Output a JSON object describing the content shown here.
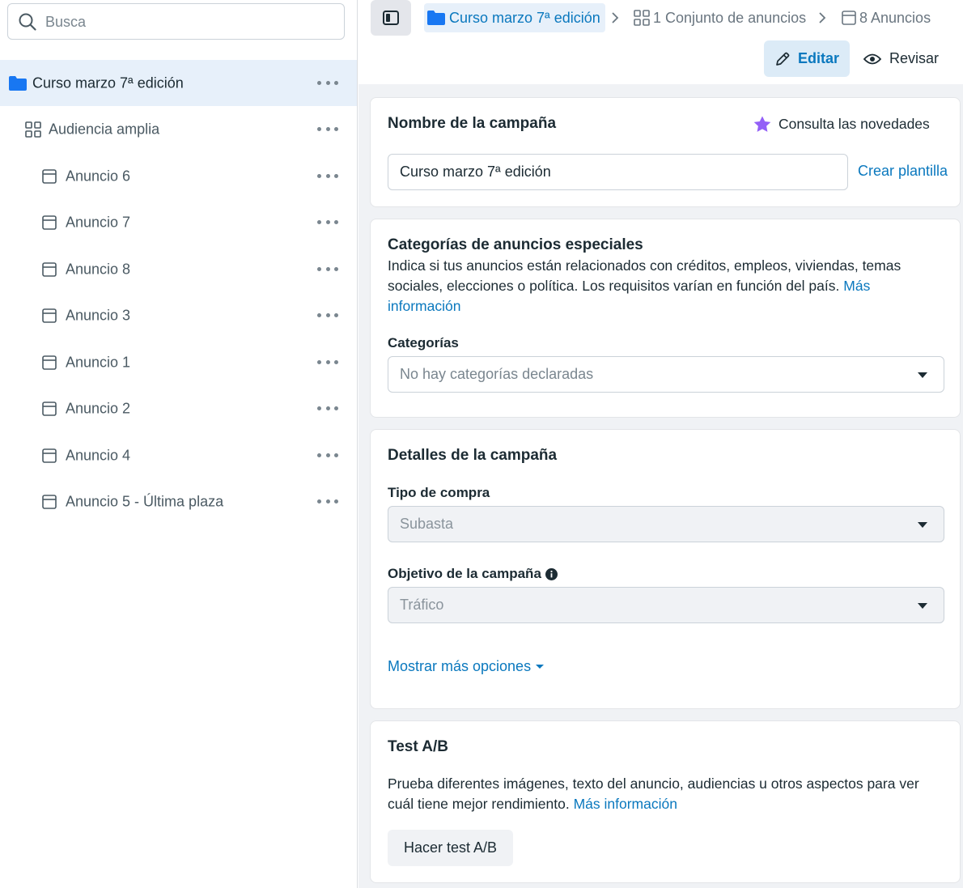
{
  "sidebar": {
    "search": {
      "placeholder": "Busca"
    },
    "items": [
      {
        "label": "Curso marzo 7ª edición",
        "icon": "folder-icon"
      },
      {
        "label": "Audiencia amplia",
        "icon": "grid-icon"
      },
      {
        "label": "Anuncio 6",
        "icon": "ad-icon"
      },
      {
        "label": "Anuncio 7",
        "icon": "ad-icon"
      },
      {
        "label": "Anuncio 8",
        "icon": "ad-icon"
      },
      {
        "label": "Anuncio 3",
        "icon": "ad-icon"
      },
      {
        "label": "Anuncio 1",
        "icon": "ad-icon"
      },
      {
        "label": "Anuncio 2",
        "icon": "ad-icon"
      },
      {
        "label": "Anuncio 4",
        "icon": "ad-icon"
      },
      {
        "label": "Anuncio 5 - Última plaza",
        "icon": "ad-icon"
      }
    ]
  },
  "header": {
    "breadcrumb": {
      "campaign": "Curso marzo 7ª edición",
      "adset": "1 Conjunto de anuncios",
      "ads": "8 Anuncios"
    },
    "edit_label": "Editar",
    "review_label": "Revisar"
  },
  "campaign_name": {
    "title": "Nombre de la campaña",
    "news_label": "Consulta las novedades",
    "value": "Curso marzo 7ª edición",
    "template_link": "Crear plantilla"
  },
  "special_categories": {
    "title": "Categorías de anuncios especiales",
    "description": "Indica si tus anuncios están relacionados con créditos, empleos, viviendas, temas sociales, elecciones o política. Los requisitos varían en función del país.",
    "link": "Más información",
    "field_label": "Categorías",
    "select_value": "No hay categorías declaradas"
  },
  "campaign_details": {
    "title": "Detalles de la campaña",
    "buy_type_label": "Tipo de compra",
    "buy_type_value": "Subasta",
    "objective_label": "Objetivo de la campaña",
    "objective_value": "Tráfico",
    "more_options": "Mostrar más opciones"
  },
  "ab_test": {
    "title": "Test A/B",
    "description": "Prueba diferentes imágenes, texto del anuncio, audiencias u otros aspectos para ver cuál tiene mejor rendimiento.",
    "link": "Más información",
    "button": "Hacer test A/B"
  },
  "colors": {
    "accent": "#0a78be",
    "selected_bg": "#e7f0fa",
    "folder": "#1877f2",
    "star": "#9360f7"
  }
}
